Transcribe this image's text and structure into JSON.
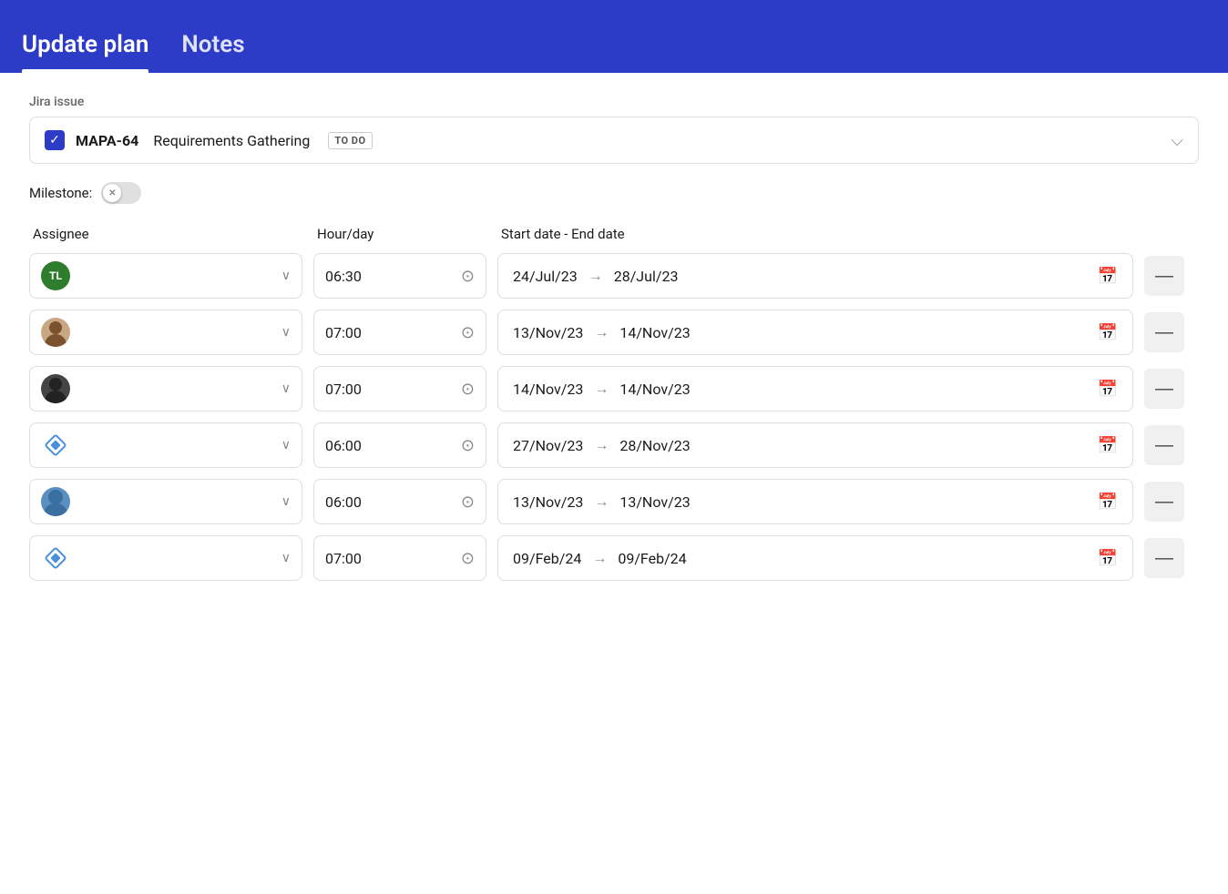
{
  "header": {
    "tab_update_plan": "Update plan",
    "tab_notes": "Notes"
  },
  "jira_section": {
    "label": "Jira issue",
    "issue_id": "MAPA-64",
    "issue_name": "Requirements Gathering",
    "issue_status": "TO DO",
    "chevron": "▾"
  },
  "milestone": {
    "label": "Milestone:"
  },
  "columns": {
    "assignee": "Assignee",
    "hour_day": "Hour/day",
    "start_end_date": "Start date - End date"
  },
  "rows": [
    {
      "avatar_type": "tl",
      "avatar_label": "TL",
      "hour": "06:30",
      "start_date": "24/Jul/23",
      "end_date": "28/Jul/23"
    },
    {
      "avatar_type": "person2",
      "avatar_label": "",
      "hour": "07:00",
      "start_date": "13/Nov/23",
      "end_date": "14/Nov/23"
    },
    {
      "avatar_type": "person3",
      "avatar_label": "",
      "hour": "07:00",
      "start_date": "14/Nov/23",
      "end_date": "14/Nov/23"
    },
    {
      "avatar_type": "diamond",
      "avatar_label": "",
      "hour": "06:00",
      "start_date": "27/Nov/23",
      "end_date": "28/Nov/23"
    },
    {
      "avatar_type": "person5",
      "avatar_label": "",
      "hour": "06:00",
      "start_date": "13/Nov/23",
      "end_date": "13/Nov/23"
    },
    {
      "avatar_type": "diamond",
      "avatar_label": "",
      "hour": "07:00",
      "start_date": "09/Feb/24",
      "end_date": "09/Feb/24"
    }
  ],
  "icons": {
    "checkmark": "✓",
    "chevron_down": "⌄",
    "clock": "⏱",
    "calendar": "🗓",
    "arrow_right": "→",
    "minus": "—",
    "close_x": "✕"
  }
}
